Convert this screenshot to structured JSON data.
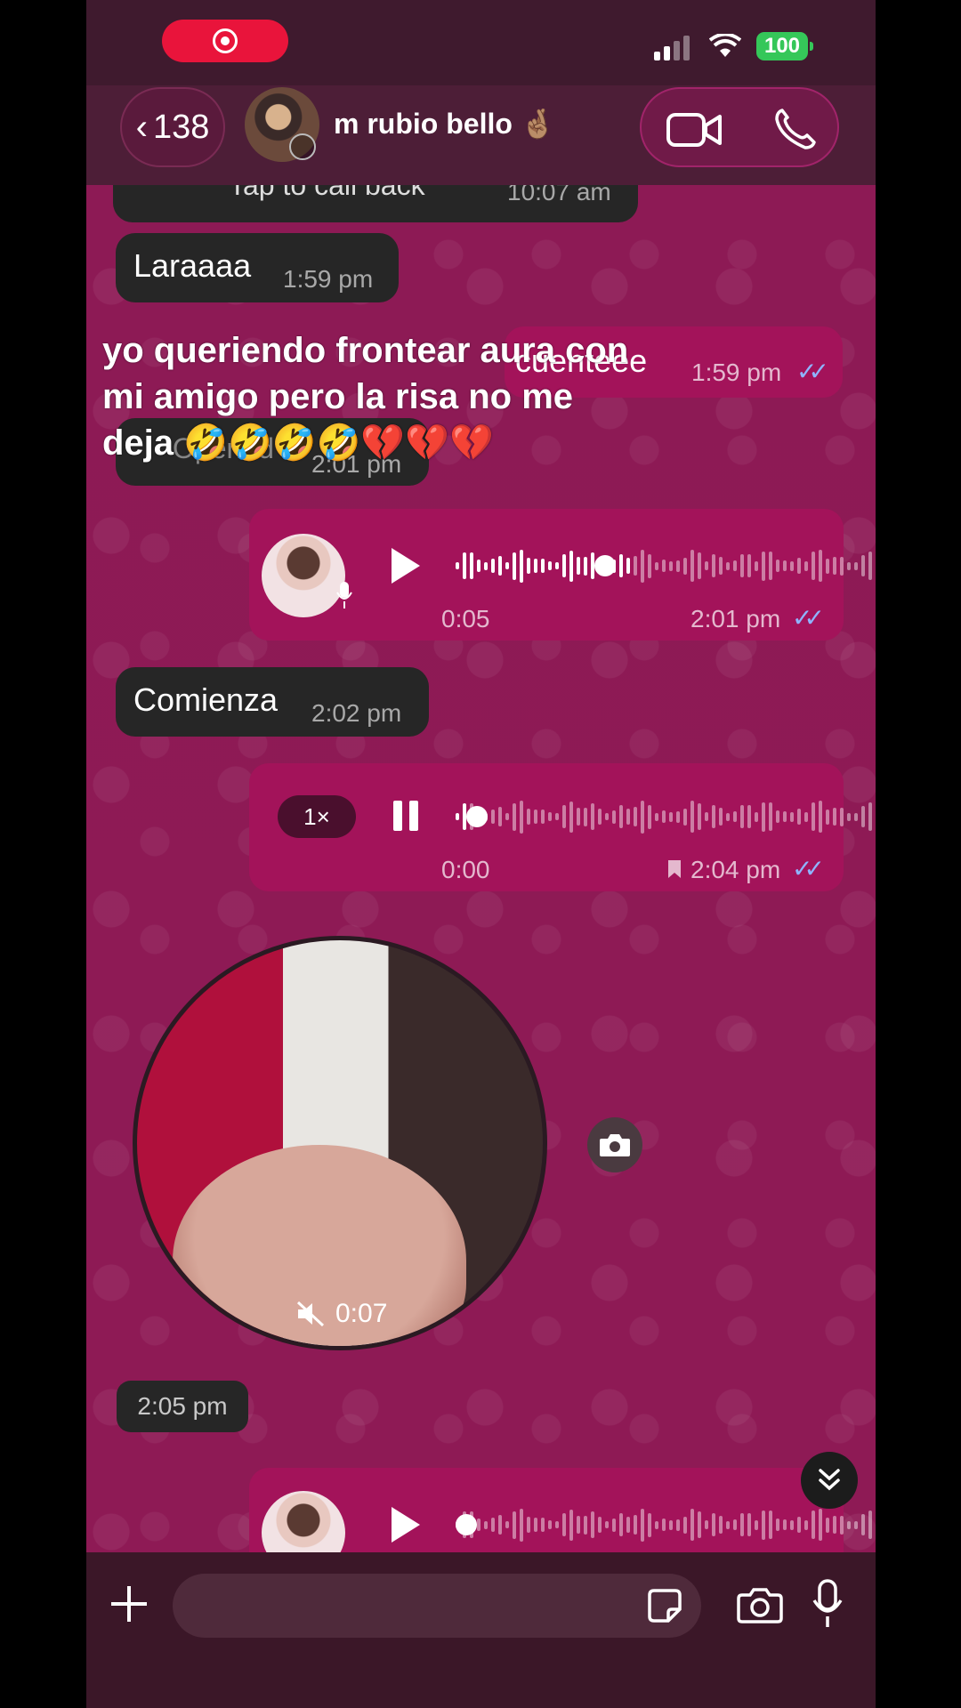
{
  "status_bar": {
    "battery": "100"
  },
  "header": {
    "back_count": "138",
    "contact_name": "m rubio bello 🤞🏽"
  },
  "messages": {
    "missed_call": {
      "text": "Tap to call back",
      "time": "10:07 am"
    },
    "laraaaa": {
      "text": "Laraaaa",
      "time": "1:59 pm"
    },
    "cuenteee": {
      "text": "cuenteee",
      "time": "1:59 pm"
    },
    "opened": {
      "text": "Opened",
      "time": "2:01 pm"
    },
    "voice1": {
      "duration": "0:05",
      "time": "2:01 pm",
      "progress": 0.38
    },
    "comienza": {
      "text": "Comienza",
      "time": "2:02 pm"
    },
    "voice2": {
      "speed": "1×",
      "duration": "0:00",
      "time": "2:04 pm",
      "progress": 0.03
    },
    "video_note": {
      "duration": "0:07",
      "time": "2:05 pm"
    },
    "voice3": {
      "progress": 0.0
    }
  },
  "overlay_caption": "yo queriendo frontear aura con mi amigo pero la risa no me deja 🤣🤣🤣🤣💔💔💔",
  "input": {
    "placeholder": ""
  },
  "colors": {
    "chat_bg": "#8e1a55",
    "outgoing": "#a3135a",
    "incoming": "#262626",
    "ticks": "#8fb4ff",
    "battery": "#35c759",
    "record": "#e9143b"
  },
  "icons": [
    "record-icon",
    "back-chevron-icon",
    "video-call-icon",
    "voice-call-icon",
    "play-icon",
    "pause-icon",
    "mic-icon",
    "muted-icon",
    "camera-icon",
    "scroll-down-icon",
    "plus-icon",
    "sticker-icon",
    "bookmark-icon"
  ]
}
